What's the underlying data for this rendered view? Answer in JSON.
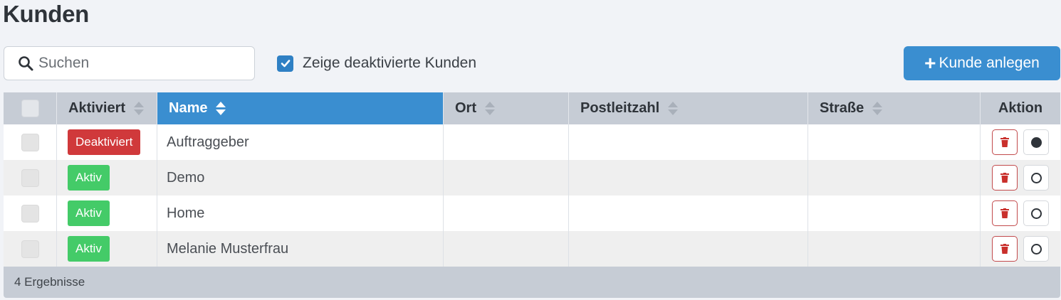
{
  "page": {
    "title": "Kunden"
  },
  "toolbar": {
    "search_placeholder": "Suchen",
    "search_value": "",
    "show_inactive_label": "Zeige deaktivierte Kunden",
    "show_inactive_checked": true,
    "add_button_label": "Kunde anlegen"
  },
  "table": {
    "columns": [
      "Aktiviert",
      "Name",
      "Ort",
      "Postleitzahl",
      "Straße",
      "Aktion"
    ],
    "sorted_column": "Name",
    "rows": [
      {
        "status": "Deaktiviert",
        "status_type": "inactive",
        "name": "Auftraggeber",
        "ort": "",
        "plz": "",
        "strasse": "",
        "selected": true
      },
      {
        "status": "Aktiv",
        "status_type": "active",
        "name": "Demo",
        "ort": "",
        "plz": "",
        "strasse": "",
        "selected": false
      },
      {
        "status": "Aktiv",
        "status_type": "active",
        "name": "Home",
        "ort": "",
        "plz": "",
        "strasse": "",
        "selected": false
      },
      {
        "status": "Aktiv",
        "status_type": "active",
        "name": "Melanie Musterfrau",
        "ort": "",
        "plz": "",
        "strasse": "",
        "selected": false
      }
    ],
    "footer": "4 Ergebnisse"
  },
  "colors": {
    "primary": "#3a8ed0",
    "inactive_badge": "#d0393b",
    "active_badge": "#44cb68",
    "header_bg": "#c6ccd5"
  },
  "icons": {
    "search": "search-icon",
    "checkbox": "check-icon",
    "add": "plus-icon",
    "delete": "trash-icon",
    "radio_selected": "radio-filled-icon",
    "radio_unselected": "radio-empty-icon",
    "sort": "sort-icon"
  }
}
